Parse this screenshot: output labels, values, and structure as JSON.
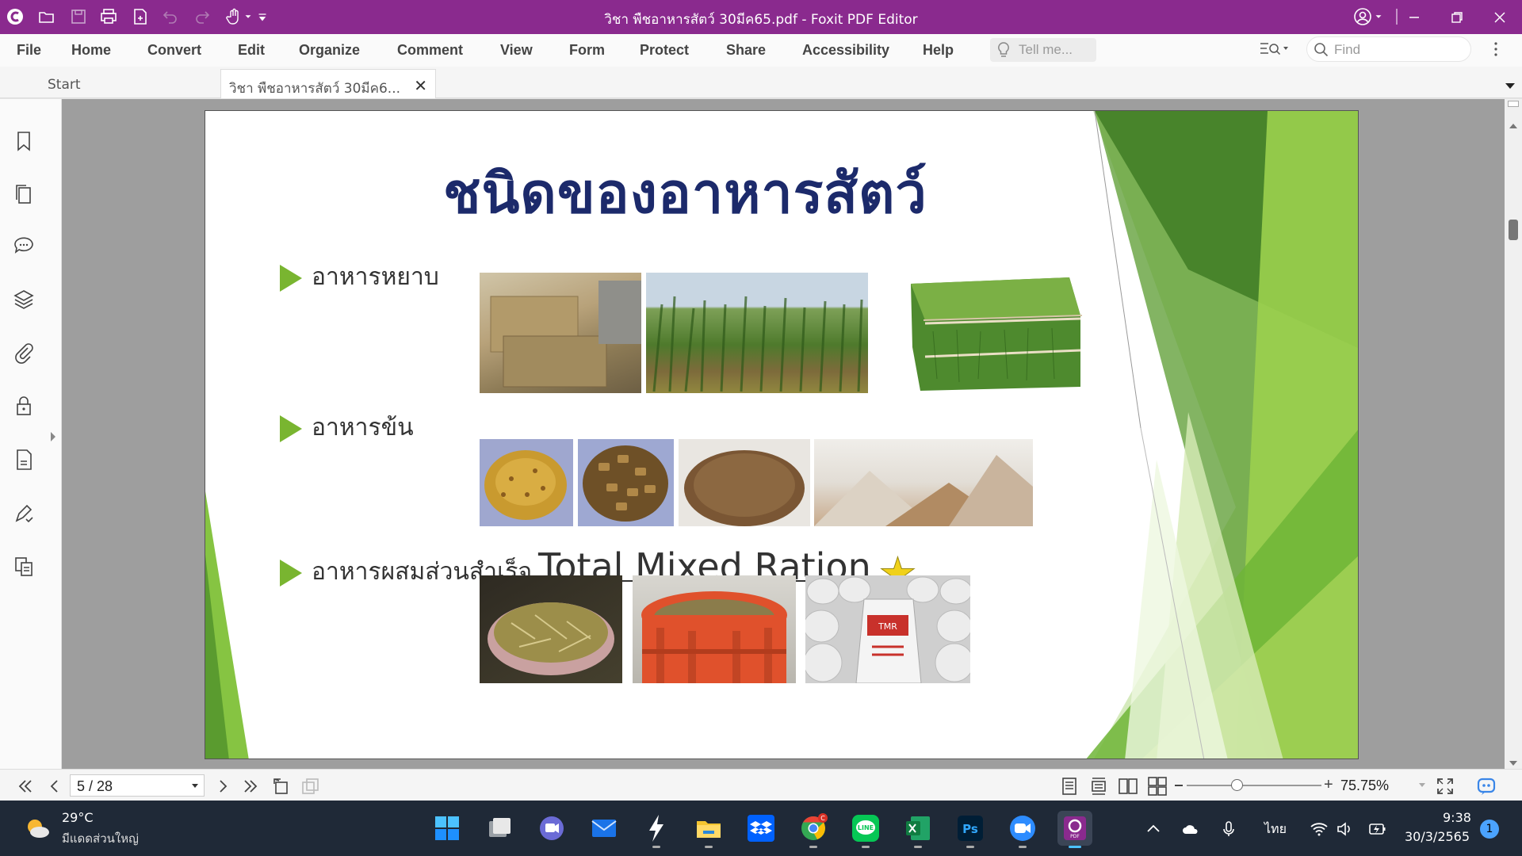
{
  "window": {
    "title": "วิชา พืชอาหารสัตว์ 30มีค65.pdf - Foxit PDF Editor",
    "accent_color": "#8a2a8e"
  },
  "menu": {
    "items": [
      "File",
      "Home",
      "Convert",
      "Edit",
      "Organize",
      "Comment",
      "View",
      "Form",
      "Protect",
      "Share",
      "Accessibility",
      "Help"
    ],
    "tell_me_placeholder": "Tell me...",
    "find_placeholder": "Find"
  },
  "tabs": {
    "start": "Start",
    "document": "วิชา พืชอาหารสัตว์ 30มีค6..."
  },
  "slide": {
    "title": "ชนิดของอาหารสัตว์",
    "bullet_1": "อาหารหยาบ",
    "bullet_2": "อาหารข้น",
    "bullet_3": "อาหารผสมส่วนสำเร็จ",
    "bullet_3_en": "Total Mixed Ration",
    "star": "★",
    "photos": {
      "roughage": [
        "hay-bales-photo",
        "sugarcane-field-photo",
        "green-hay-bale-photo"
      ],
      "concentrate": [
        "mixed-feed-pile-photo",
        "feed-pellets-photo",
        "feed-sack-photo",
        "ground-feed-piles-photo"
      ],
      "tmr": [
        "tmr-in-hands-photo",
        "tmr-mixer-photo",
        "tmr-bags-photo"
      ]
    },
    "tmr_bag_label": "TMR"
  },
  "navigation": {
    "page_indicator": "5 / 28",
    "zoom": "75.75%"
  },
  "taskbar": {
    "weather_temp": "29°C",
    "weather_desc": "มีแดดส่วนใหญ่",
    "language": "ไทย",
    "time": "9:38",
    "date": "30/3/2565",
    "notifications": "1",
    "chrome_badge": "C"
  }
}
